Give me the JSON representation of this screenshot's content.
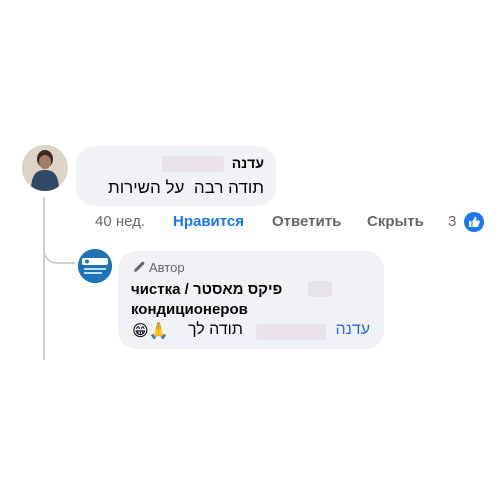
{
  "comment": {
    "author": "עדנה",
    "text": "תודה רבה  על השירות",
    "time": "40 нед.",
    "like": "Нравится",
    "reply": "Ответить",
    "hide": "Скрыть",
    "reactions_count": "3"
  },
  "reply": {
    "badge": "Автор",
    "author_line1": "чистка / פיקס מאסטר",
    "author_line2": "кондиционеров",
    "mention": "עדנה",
    "text": "תודה לך",
    "emoji": "😁🙏",
    "avatar_logo_text": "מאסטר\nfix"
  },
  "colors": {
    "bubble": "#f0f2f5",
    "meta": "#65676b",
    "link": "#1877f2",
    "mention": "#216fdb",
    "thread_line": "#ced0d4"
  }
}
